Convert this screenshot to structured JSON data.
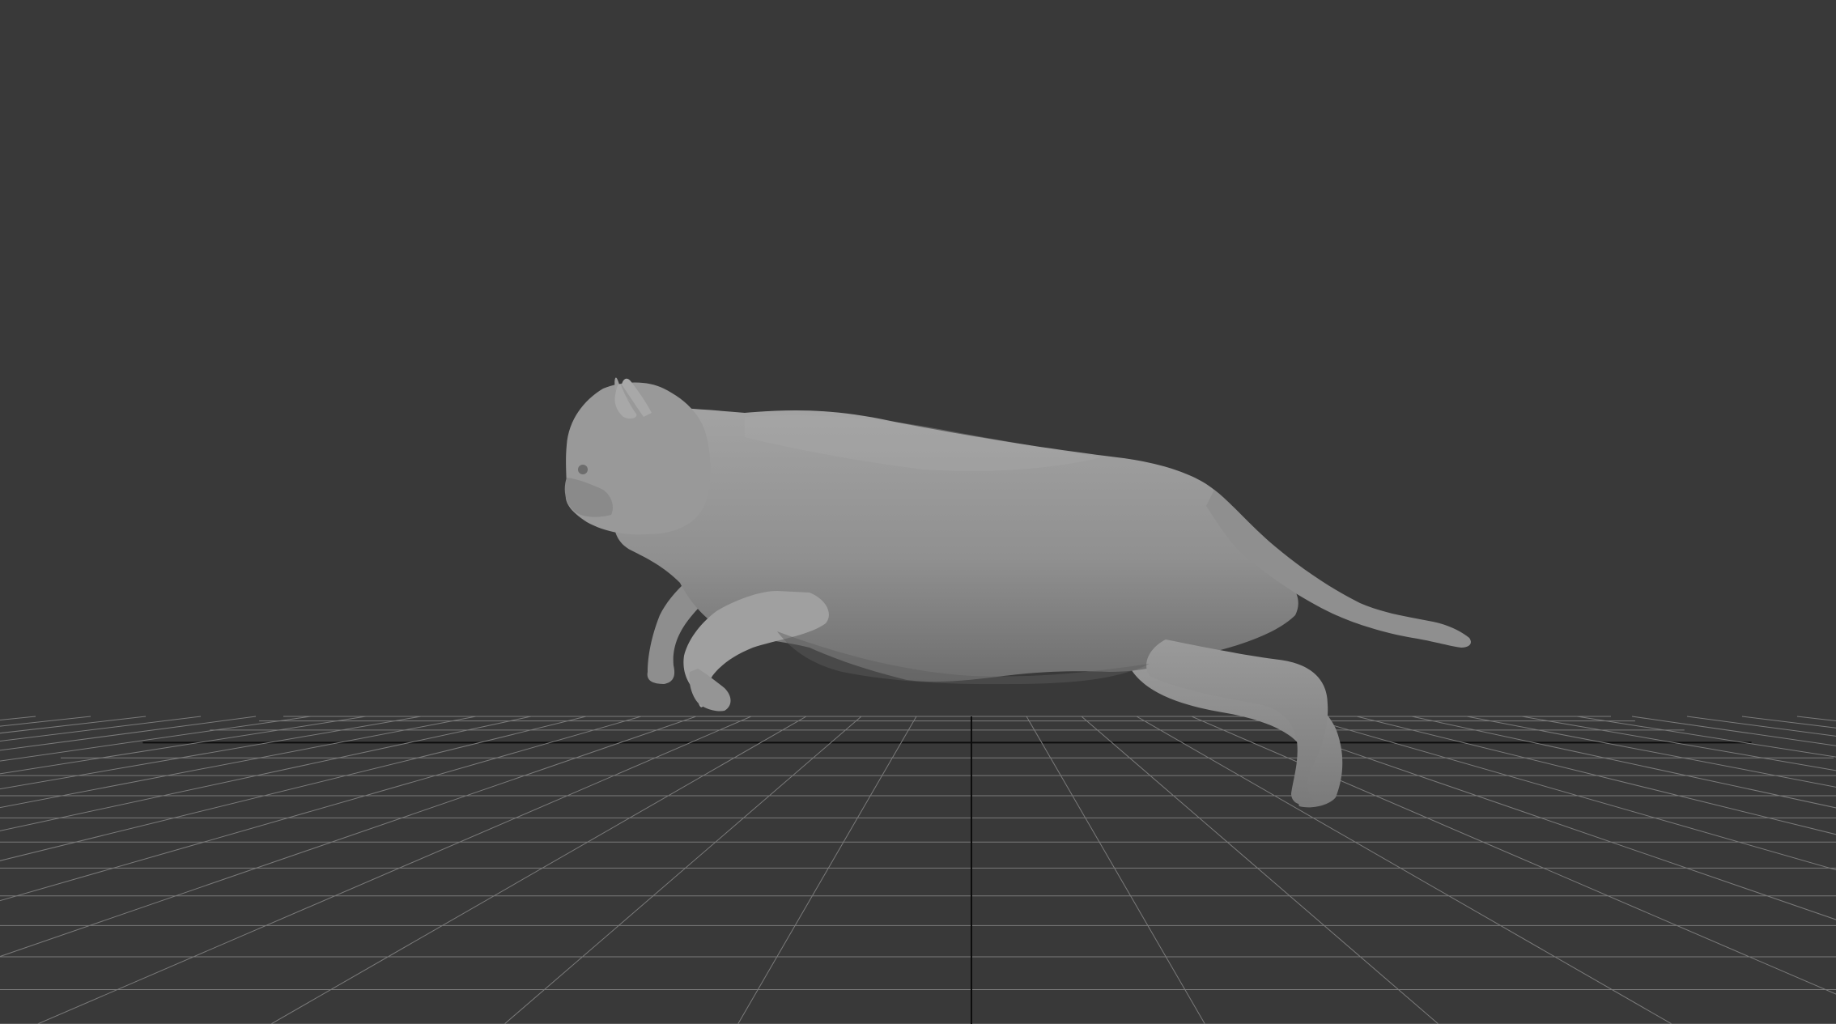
{
  "viewport": {
    "background_color": "#393939",
    "grid_line_color": "#7a7a7a",
    "grid_axis_color": "#0d0d0d",
    "model_color": "#8c8c8c",
    "model_highlight_color": "#a6a6a6",
    "model_shadow_color": "#646464",
    "model_subject": "cat-leaping"
  }
}
